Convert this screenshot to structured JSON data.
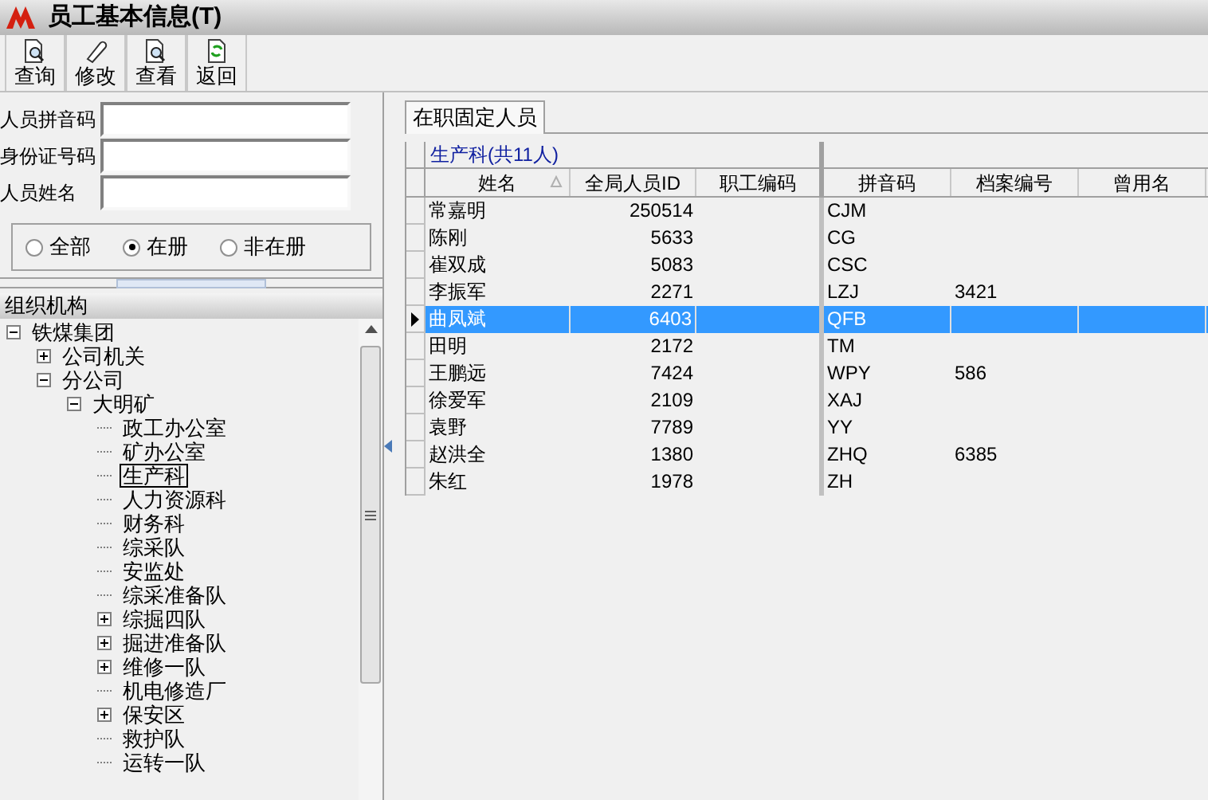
{
  "window": {
    "title": "员工基本信息(T)"
  },
  "toolbar": [
    {
      "label": "查询",
      "kind": "search"
    },
    {
      "label": "修改",
      "kind": "edit"
    },
    {
      "label": "查看",
      "kind": "search"
    },
    {
      "label": "返回",
      "kind": "back"
    }
  ],
  "fields": [
    {
      "label": "人员拼音码"
    },
    {
      "label": "身份证号码"
    },
    {
      "label": "人员姓名"
    }
  ],
  "status_filter": [
    {
      "label": "全部",
      "selected": false
    },
    {
      "label": "在册",
      "selected": true
    },
    {
      "label": "非在册",
      "selected": false
    }
  ],
  "org_tree": {
    "title": "组织机构",
    "nodes": [
      {
        "label": "铁煤集团",
        "kind": "folder",
        "expanded": true,
        "selected": false,
        "children": [
          {
            "label": "公司机关",
            "kind": "folder",
            "expanded": false,
            "selected": false
          },
          {
            "label": "分公司",
            "kind": "folder",
            "expanded": true,
            "selected": false,
            "children": [
              {
                "label": "大明矿",
                "kind": "folder",
                "expanded": true,
                "selected": false,
                "children": [
                  {
                    "label": "政工办公室",
                    "kind": "leaf",
                    "selected": false
                  },
                  {
                    "label": "矿办公室",
                    "kind": "leaf",
                    "selected": false
                  },
                  {
                    "label": "生产科",
                    "kind": "leaf",
                    "selected": true
                  },
                  {
                    "label": "人力资源科",
                    "kind": "leaf",
                    "selected": false
                  },
                  {
                    "label": "财务科",
                    "kind": "leaf",
                    "selected": false
                  },
                  {
                    "label": "综采队",
                    "kind": "leaf",
                    "selected": false
                  },
                  {
                    "label": "安监处",
                    "kind": "leaf",
                    "selected": false
                  },
                  {
                    "label": "综采准备队",
                    "kind": "leaf",
                    "selected": false
                  },
                  {
                    "label": "综掘四队",
                    "kind": "folder",
                    "expanded": false,
                    "selected": false
                  },
                  {
                    "label": "掘进准备队",
                    "kind": "folder",
                    "expanded": false,
                    "selected": false
                  },
                  {
                    "label": "维修一队",
                    "kind": "folder",
                    "expanded": false,
                    "selected": false
                  },
                  {
                    "label": "机电修造厂",
                    "kind": "leaf",
                    "selected": false
                  },
                  {
                    "label": "保安区",
                    "kind": "folder",
                    "expanded": false,
                    "selected": false
                  },
                  {
                    "label": "救护队",
                    "kind": "leaf",
                    "selected": false
                  },
                  {
                    "label": "运转一队",
                    "kind": "leaf",
                    "selected": false
                  }
                ]
              }
            ]
          }
        ]
      }
    ]
  },
  "tabs": [
    {
      "label": "在职固定人员",
      "selected": true
    }
  ],
  "table": {
    "group_header": "生产科(共11人)",
    "columns": [
      {
        "label": "姓名",
        "sorted": true
      },
      {
        "label": "全局人员ID",
        "sorted": false
      },
      {
        "label": "职工编码",
        "sorted": false
      },
      {
        "label": "拼音码",
        "sorted": false
      },
      {
        "label": "档案编号",
        "sorted": false
      },
      {
        "label": "曾用名",
        "sorted": false
      }
    ],
    "rows": [
      {
        "cells": [
          "常嘉明",
          "250514",
          "",
          "CJM",
          "",
          ""
        ],
        "selected": false
      },
      {
        "cells": [
          "陈刚",
          "5633",
          "",
          "CG",
          "",
          ""
        ],
        "selected": false
      },
      {
        "cells": [
          "崔双成",
          "5083",
          "",
          "CSC",
          "",
          ""
        ],
        "selected": false
      },
      {
        "cells": [
          "李振军",
          "2271",
          "",
          "LZJ",
          "3421",
          ""
        ],
        "selected": false
      },
      {
        "cells": [
          "曲凤斌",
          "6403",
          "",
          "QFB",
          "",
          ""
        ],
        "selected": true
      },
      {
        "cells": [
          "田明",
          "2172",
          "",
          "TM",
          "",
          ""
        ],
        "selected": false
      },
      {
        "cells": [
          "王鹏远",
          "7424",
          "",
          "WPY",
          "586",
          ""
        ],
        "selected": false
      },
      {
        "cells": [
          "徐爱军",
          "2109",
          "",
          "XAJ",
          "",
          ""
        ],
        "selected": false
      },
      {
        "cells": [
          "袁野",
          "7789",
          "",
          "YY",
          "",
          ""
        ],
        "selected": false
      },
      {
        "cells": [
          "赵洪全",
          "1380",
          "",
          "ZHQ",
          "6385",
          ""
        ],
        "selected": false
      },
      {
        "cells": [
          "朱红",
          "1978",
          "",
          "ZH",
          "",
          ""
        ],
        "selected": false
      }
    ]
  }
}
